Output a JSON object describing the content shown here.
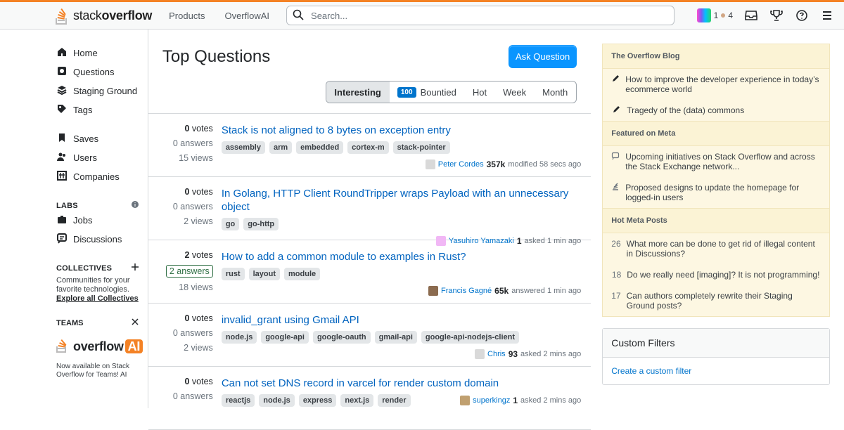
{
  "brand": {
    "logo_text_light": "stack",
    "logo_text_bold": "overflow"
  },
  "nav": {
    "products": "Products",
    "overflowai": "OverflowAI"
  },
  "search": {
    "placeholder": "Search..."
  },
  "top_right": {
    "rep_left": "1",
    "rep_right": "4"
  },
  "left_nav": {
    "home": "Home",
    "questions": "Questions",
    "staging": "Staging Ground",
    "tags": "Tags",
    "saves": "Saves",
    "users": "Users",
    "companies": "Companies",
    "labs": "LABS",
    "jobs": "Jobs",
    "discussions": "Discussions",
    "collectives": "COLLECTIVES",
    "collectives_text": "Communities for your favorite technologies.",
    "explore": "Explore all Collectives",
    "teams": "TEAMS",
    "teams_logo_left": "overflow",
    "teams_logo_ai": "AI",
    "teams_blurb": "Now available on Stack Overflow for Teams! AI"
  },
  "main": {
    "title": "Top Questions",
    "ask_label": "Ask Question",
    "tabs": [
      {
        "label": "Interesting"
      },
      {
        "badge": "100",
        "label": "Bountied"
      },
      {
        "label": "Hot"
      },
      {
        "label": "Week"
      },
      {
        "label": "Month"
      }
    ],
    "questions": [
      {
        "votes": "0",
        "votes_word": "votes",
        "answers": "0 answers",
        "views": "15 views",
        "title": "Stack is not aligned to 8 bytes on exception entry",
        "tags": [
          "assembly",
          "arm",
          "embedded",
          "cortex-m",
          "stack-pointer"
        ],
        "user": "Peter Cordes",
        "rep": "357k",
        "action": "modified 58 secs ago"
      },
      {
        "votes": "0",
        "votes_word": "votes",
        "answers": "0 answers",
        "views": "2 views",
        "title": "In Golang, HTTP Client RoundTripper wraps Payload with an unnecessary object",
        "tags": [
          "go",
          "go-http"
        ],
        "user": "Yasuhiro Yamazaki",
        "rep": "1",
        "action": "asked 1 min ago"
      },
      {
        "votes": "2",
        "votes_word": "votes",
        "answers": "2 answers",
        "views": "18 views",
        "title": "How to add a common module to examples in Rust?",
        "tags": [
          "rust",
          "layout",
          "module"
        ],
        "user": "Francis Gagné",
        "rep": "65k",
        "action": "answered 1 min ago"
      },
      {
        "votes": "0",
        "votes_word": "votes",
        "answers": "0 answers",
        "views": "2 views",
        "title": "invalid_grant using Gmail API",
        "tags": [
          "node.js",
          "google-api",
          "google-oauth",
          "gmail-api",
          "google-api-nodejs-client"
        ],
        "user": "Chris",
        "rep": "93",
        "action": "asked 2 mins ago"
      },
      {
        "votes": "0",
        "votes_word": "votes",
        "answers": "0 answers",
        "views": "",
        "title": "Can not set DNS record in varcel for render custom domain",
        "tags": [
          "reactjs",
          "node.js",
          "express",
          "next.js",
          "render"
        ],
        "user": "superkingz",
        "rep": "1",
        "action": "asked 2 mins ago"
      }
    ]
  },
  "right": {
    "blog_title": "The Overflow Blog",
    "blog_items": [
      "How to improve the developer experience in today’s ecommerce world",
      "Tragedy of the (data) commons"
    ],
    "meta_title": "Featured on Meta",
    "meta_items": [
      "Upcoming initiatives on Stack Overflow and across the Stack Exchange network...",
      "Proposed designs to update the homepage for logged-in users"
    ],
    "hot_title": "Hot Meta Posts",
    "hot_items": [
      {
        "n": "26",
        "t": "What more can be done to get rid of illegal content in Discussions?"
      },
      {
        "n": "18",
        "t": "Do we really need [imaging]? It is not programming!"
      },
      {
        "n": "17",
        "t": "Can authors completely rewrite their Staging Ground posts?"
      }
    ],
    "custom_filters": "Custom Filters",
    "create_filter": "Create a custom filter"
  }
}
